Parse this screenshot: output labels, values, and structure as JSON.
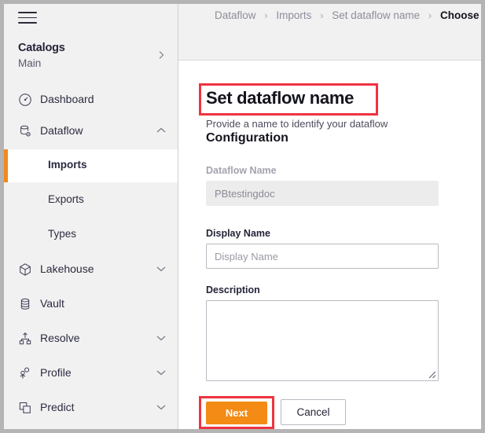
{
  "sidebar": {
    "menu_icon": "hamburger-icon",
    "catalog": {
      "title": "Catalogs",
      "subtitle": "Main",
      "chevron": "chevron-right-icon"
    },
    "items": [
      {
        "label": "Dashboard",
        "icon": "gauge-icon",
        "chevron": "none",
        "expanded": false
      },
      {
        "label": "Dataflow",
        "icon": "database-gear-icon",
        "chevron": "chevron-up-icon",
        "expanded": true
      },
      {
        "label": "Lakehouse",
        "icon": "cube-icon",
        "chevron": "chevron-down-icon",
        "expanded": false
      },
      {
        "label": "Vault",
        "icon": "disks-icon",
        "chevron": "none",
        "expanded": false
      },
      {
        "label": "Resolve",
        "icon": "merge-icon",
        "chevron": "chevron-down-icon",
        "expanded": false
      },
      {
        "label": "Profile",
        "icon": "person-icon",
        "chevron": "chevron-down-icon",
        "expanded": false
      },
      {
        "label": "Predict",
        "icon": "layers-icon",
        "chevron": "chevron-down-icon",
        "expanded": false
      }
    ],
    "dataflow_children": [
      {
        "label": "Imports",
        "active": true
      },
      {
        "label": "Exports",
        "active": false
      },
      {
        "label": "Types",
        "active": false
      }
    ]
  },
  "breadcrumb": {
    "separator": "›",
    "items": [
      {
        "label": "Dataflow",
        "current": false
      },
      {
        "label": "Imports",
        "current": false
      },
      {
        "label": "Set dataflow name",
        "current": false
      },
      {
        "label": "Choose conn",
        "current": true
      }
    ]
  },
  "main": {
    "title": "Set dataflow name",
    "subtitle": "Provide a name to identify your dataflow",
    "section_title": "Configuration",
    "fields": {
      "dataflow_name": {
        "label": "Dataflow Name",
        "value": "PBtestingdoc",
        "placeholder": "Dataflow Name",
        "disabled": true
      },
      "display_name": {
        "label": "Display Name",
        "value": "",
        "placeholder": "Display Name",
        "disabled": false
      },
      "description": {
        "label": "Description",
        "value": "",
        "placeholder": "",
        "disabled": false
      }
    },
    "actions": {
      "next_label": "Next",
      "cancel_label": "Cancel"
    }
  },
  "colors": {
    "accent_orange": "#f38b14",
    "highlight_red": "#ef3340",
    "sidebar_bg": "#f1f1f1",
    "text_dark": "#14141e",
    "text_muted": "#8d8d9b"
  }
}
